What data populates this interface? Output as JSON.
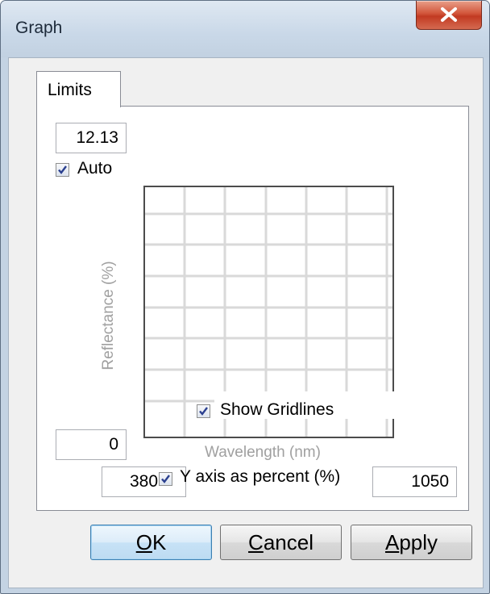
{
  "window": {
    "title": "Graph"
  },
  "tabs": [
    {
      "label": "Limits"
    }
  ],
  "limits": {
    "y_max": "12.13",
    "y_min": "0",
    "x_min": "380",
    "x_max": "1050",
    "auto_label": "Auto",
    "auto_checked": true,
    "show_gridlines_label": "Show Gridlines",
    "show_gridlines_checked": true,
    "y_percent_label": "Y axis as percent (%)",
    "y_percent_checked": true
  },
  "chart": {
    "xlabel": "Wavelength (nm)",
    "ylabel": "Reflectance (%)"
  },
  "buttons": {
    "ok_mnemonic": "O",
    "ok_rest": "K",
    "cancel_mnemonic": "C",
    "cancel_rest": "ancel",
    "apply_mnemonic": "A",
    "apply_rest": "pply"
  },
  "icons": {
    "close": "close-icon",
    "check": "checkmark-icon"
  },
  "colors": {
    "close_button": "#c8442a",
    "default_button_border": "#3c7fb1",
    "checkmark": "#2a3f8f"
  }
}
